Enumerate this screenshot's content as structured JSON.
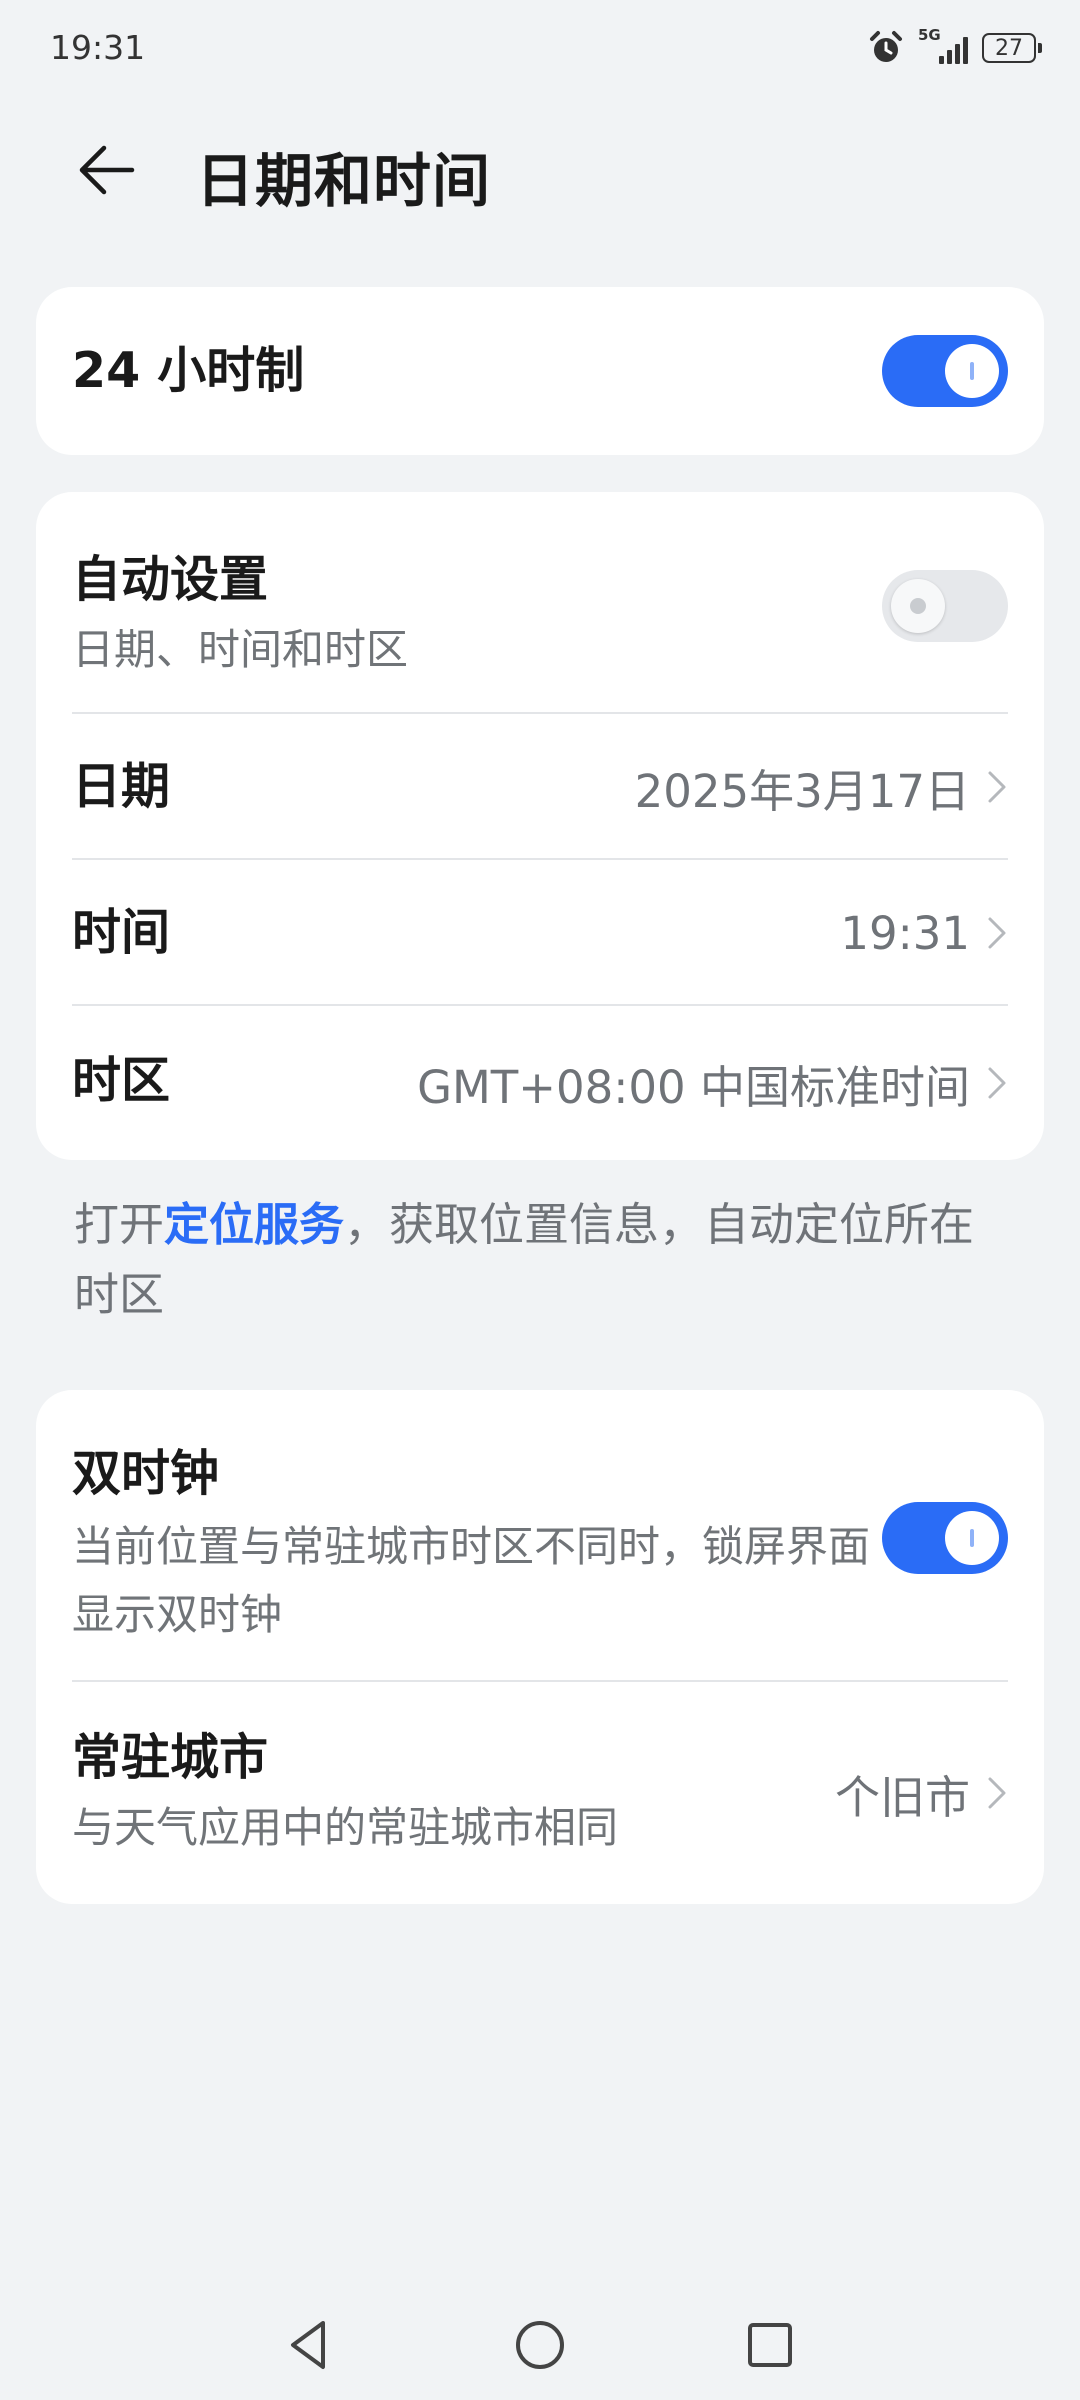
{
  "status_bar": {
    "time": "19:31",
    "network": "5G",
    "battery": "27",
    "icons": [
      "alarm-icon",
      "signal-icon",
      "battery-icon"
    ]
  },
  "header": {
    "title": "日期和时间",
    "back_icon": "arrow-left-icon"
  },
  "format_card": {
    "label": "24 小时制",
    "enabled": true
  },
  "auto_card": {
    "auto_set": {
      "label": "自动设置",
      "subtitle": "日期、时间和时区",
      "enabled": false
    },
    "date": {
      "label": "日期",
      "value": "2025年3月17日"
    },
    "time": {
      "label": "时间",
      "value": "19:31"
    },
    "timezone": {
      "label": "时区",
      "value": "GMT+08:00 中国标准时间"
    }
  },
  "note": {
    "prefix": "打开",
    "link": "定位服务",
    "suffix": "，获取位置信息，自动定位所在时区"
  },
  "dual_clock_card": {
    "dual_clock": {
      "label": "双时钟",
      "subtitle": "当前位置与常驻城市时区不同时，锁屏界面显示双时钟",
      "enabled": true
    },
    "home_city": {
      "label": "常驻城市",
      "subtitle": "与天气应用中的常驻城市相同",
      "value": "个旧市"
    }
  },
  "colors": {
    "accent": "#2a6cf6",
    "background": "#f1f3f5",
    "card": "#ffffff",
    "secondary_text": "#6f7378"
  },
  "nav_bar": {
    "icons": [
      "nav-back-icon",
      "nav-home-icon",
      "nav-recents-icon"
    ]
  }
}
